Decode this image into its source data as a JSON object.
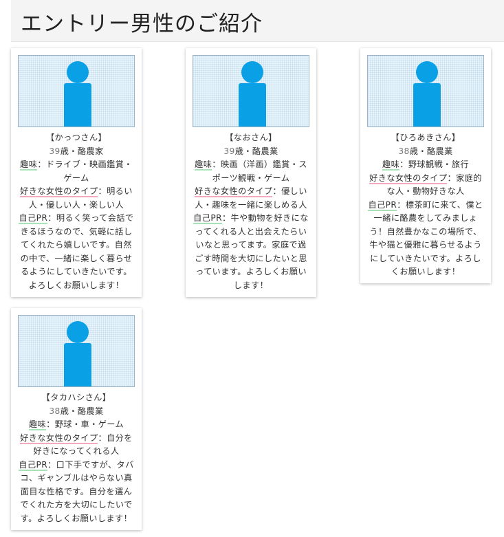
{
  "page": {
    "title": "エントリー男性のご紹介"
  },
  "labels": {
    "hobby": "趣味",
    "type": "好きな女性のタイプ",
    "pr": "自己PR",
    "sep": "："
  },
  "entries": [
    {
      "name": "【かっつさん】",
      "age": "39",
      "age_suffix": "歳・酪農家",
      "hobby": "ドライブ・映画鑑賞・ゲーム",
      "type": "明るい人・優しい人・楽しい人",
      "pr": "明るく笑って会話できるほうなので、気軽に話してくれたら嬉しいです。自然の中で、一緒に楽しく暮らせるようにしていきたいです。よろしくお願いします！"
    },
    {
      "name": "【なおさん】",
      "age": "39",
      "age_suffix": "歳・酪農業",
      "hobby": "映画（洋画）鑑賞・スポーツ観戦・ゲーム",
      "type": "優しい人・趣味を一緒に楽しめる人",
      "pr": "牛や動物を好きになってくれる人と出会えたらいいなと思ってます。家庭で過ごす時間を大切にしたいと思っています。よろしくお願いします！"
    },
    {
      "name": "【ひろあきさん】",
      "age": "38",
      "age_suffix": "歳・酪農業",
      "hobby": "野球観戦・旅行",
      "type": "家庭的な人・動物好きな人",
      "pr": "標茶町に来て、僕と一緒に酪農をしてみましょう！自然豊かなこの場所で、牛や猫と優雅に暮らせるようにしていきたいです。よろしくお願いします！"
    },
    {
      "name": "【タカハシさん】",
      "age": "38",
      "age_suffix": "歳・酪農業",
      "hobby": "野球・車・ゲーム",
      "type": "自分を好きになってくれる人",
      "pr": "口下手ですが、タバコ、ギャンブルはやらない真面目な性格です。自分を選んでくれた方を大切にしたいです。よろしくお願いします！"
    }
  ],
  "colors": {
    "header_bg": "#f4f4f4",
    "avatar": "#0aa0e6",
    "hobby_underline": "#a8e2b9",
    "type_underline": "#f4a9bf",
    "pr_underline": "#a8e2b9"
  },
  "icons": {
    "avatar": "person-silhouette-icon"
  }
}
